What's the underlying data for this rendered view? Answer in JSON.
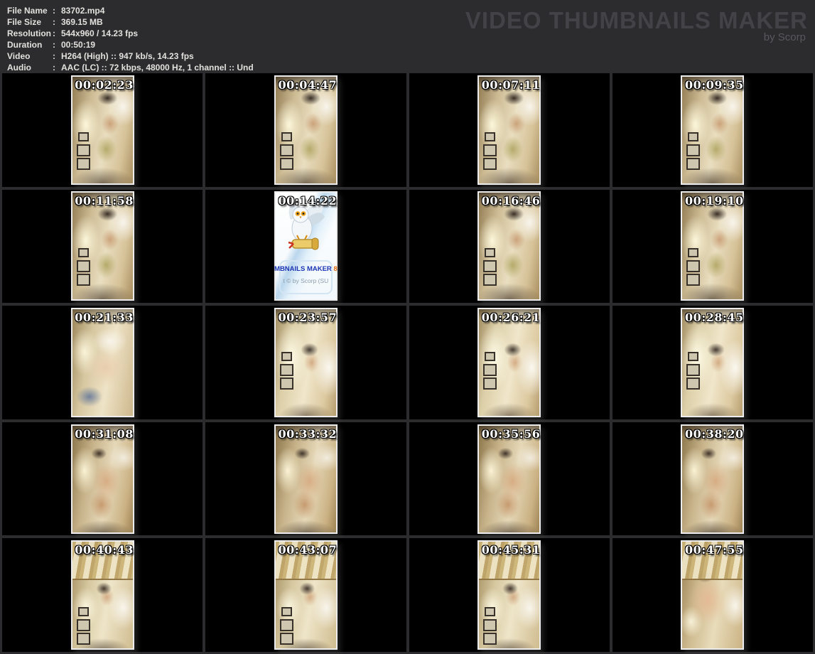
{
  "header": {
    "separator": ":",
    "fields": [
      {
        "label": "File Name",
        "value": "83702.mp4"
      },
      {
        "label": "File Size",
        "value": "369.15 MB"
      },
      {
        "label": "Resolution",
        "value": "544x960 / 14.23 fps"
      },
      {
        "label": "Duration",
        "value": "00:50:19"
      },
      {
        "label": "Video",
        "value": "H264 (High) :: 947 kb/s, 14.23 fps"
      },
      {
        "label": "Audio",
        "value": "AAC (LC) :: 72 kbps, 48000 Hz, 1 channel :: Und"
      }
    ],
    "logo": {
      "title": "VIDEO THUMBNAILS MAKER",
      "subtitle": "by Scorp"
    }
  },
  "grid": {
    "columns": 4,
    "rows": 5,
    "cells": [
      {
        "time": "00:02:23",
        "scene": "a"
      },
      {
        "time": "00:04:47",
        "scene": "a"
      },
      {
        "time": "00:07:11",
        "scene": "a"
      },
      {
        "time": "00:09:35",
        "scene": "a"
      },
      {
        "time": "00:11:58",
        "scene": "a"
      },
      {
        "time": "00:14:22",
        "scene": "wm"
      },
      {
        "time": "00:16:46",
        "scene": "a"
      },
      {
        "time": "00:19:10",
        "scene": "a"
      },
      {
        "time": "00:21:33",
        "scene": "b"
      },
      {
        "time": "00:23:57",
        "scene": "a3"
      },
      {
        "time": "00:26:21",
        "scene": "a3"
      },
      {
        "time": "00:28:45",
        "scene": "a3"
      },
      {
        "time": "00:31:08",
        "scene": "c"
      },
      {
        "time": "00:33:32",
        "scene": "c"
      },
      {
        "time": "00:35:56",
        "scene": "c"
      },
      {
        "time": "00:38:20",
        "scene": "c"
      },
      {
        "time": "00:40:43",
        "scene": "d"
      },
      {
        "time": "00:43:07",
        "scene": "d"
      },
      {
        "time": "00:45:31",
        "scene": "d"
      },
      {
        "time": "00:47:55",
        "scene": "e"
      }
    ]
  },
  "watermark": {
    "icon": "owl-with-scroll-icon",
    "line1": "MBNAILS MAKER",
    "line1_suffix": "8",
    "line2": "t © by Scorp (SU"
  },
  "colors": {
    "background": "#2c2c2e",
    "cell_background": "#000000",
    "header_text": "#e3e1dd",
    "logo_text": "#434347",
    "timestamp_text": "#ffffff",
    "watermark_blue": "#1c35b5",
    "watermark_orange": "#e06a10"
  }
}
